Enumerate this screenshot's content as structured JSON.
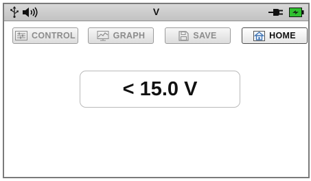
{
  "status_bar": {
    "title": "V",
    "icons": [
      "usb-icon",
      "speaker-icon",
      "power-plug-icon",
      "battery-charging-icon"
    ]
  },
  "toolbar": {
    "control_label": "CONTROL",
    "graph_label": "GRAPH",
    "save_label": "SAVE",
    "home_label": "HOME"
  },
  "readout": {
    "value": "< 15.0 V"
  },
  "colors": {
    "status_bar_bg": "#c8c8c8",
    "battery_green": "#2fbf2f",
    "disabled_text": "#8c8c8c",
    "active_text": "#111111"
  }
}
